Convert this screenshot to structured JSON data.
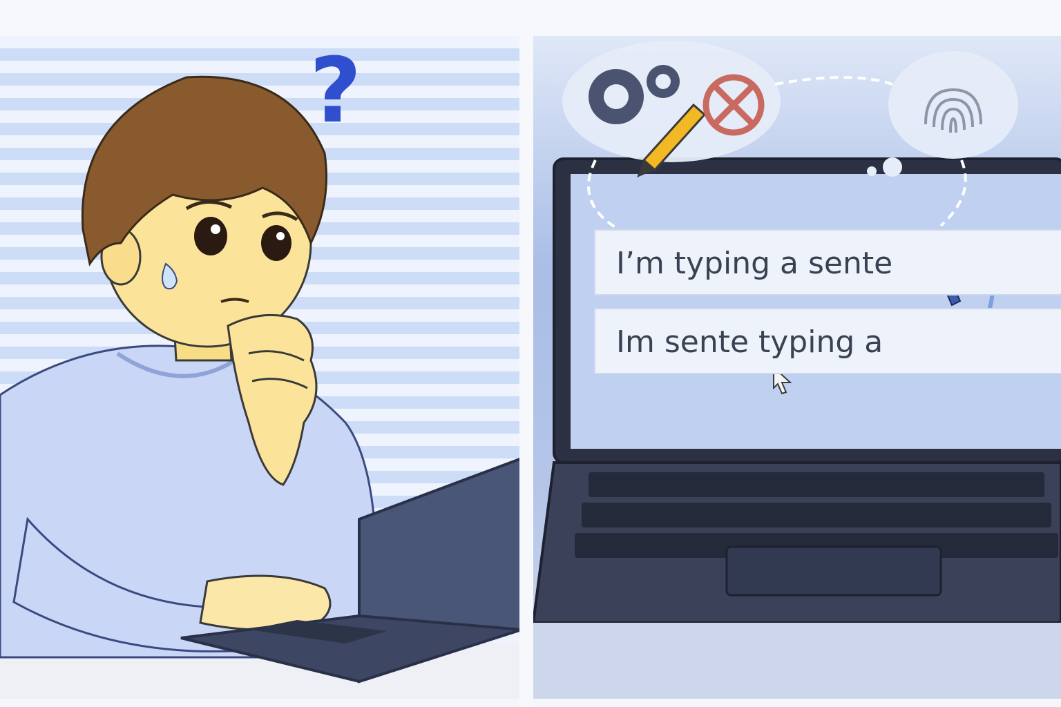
{
  "question_mark": "?",
  "screen": {
    "line1": "I’m typing a sente",
    "line2": "Im sente typing a"
  },
  "icons": [
    "gear-icon",
    "pencil-icon",
    "no-sign-icon",
    "fingerprint-icon",
    "cursor-icon",
    "question-mark-icon"
  ],
  "colors": {
    "accent": "#2f4fcf",
    "shirt": "#c9d6f6",
    "hair": "#8a5a2f",
    "laptop": "#3f4a66",
    "highlight": "#f2b925"
  }
}
